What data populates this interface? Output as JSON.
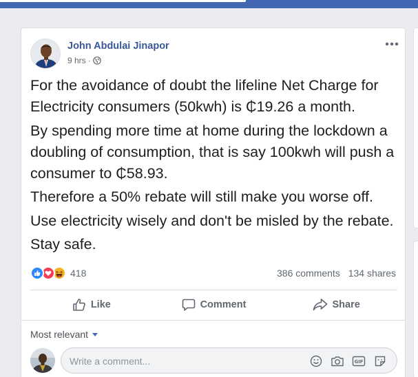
{
  "colors": {
    "header_blue": "#4267b2",
    "link_blue": "#385898",
    "text": "#1c1e21",
    "secondary_text": "#606770",
    "background": "#e9ebee"
  },
  "post": {
    "author": "John Abdulai Jinapor",
    "time": "9 hrs",
    "separator": "·",
    "privacy_icon": "globe-icon",
    "menu_icon": "more-options-icon",
    "paragraphs": [
      "For the avoidance of doubt the lifeline Net Charge for Electricity consumers (50kwh) is ₵19.26 a month.",
      "By spending more time at home during the lockdown a doubling of consumption, that is say 100kwh will push a consumer to ₵58.93.",
      "Therefore a 50% rebate will still make you worse off.",
      "Use electricity wisely and don't be misled by the rebate.",
      "Stay safe."
    ],
    "reactions": {
      "icons": [
        "like-reaction-icon",
        "love-reaction-icon",
        "haha-reaction-icon"
      ],
      "count": "418"
    },
    "comments_count": "386 comments",
    "shares_count": "134 shares",
    "actions": {
      "like": "Like",
      "comment": "Comment",
      "share": "Share"
    }
  },
  "comments": {
    "sort_label": "Most relevant",
    "input_placeholder": "Write a comment...",
    "input_icons": [
      "emoji-icon",
      "camera-icon",
      "gif-icon",
      "sticker-icon"
    ]
  }
}
